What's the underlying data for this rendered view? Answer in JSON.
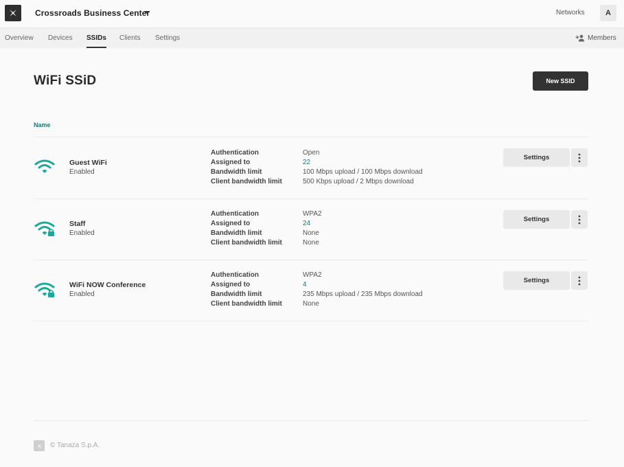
{
  "header": {
    "org_name": "Crossroads Business Center",
    "networks_label": "Networks",
    "avatar_initial": "A",
    "logo_icon": "tanaza-logo-icon"
  },
  "tabs": [
    {
      "label": "Overview",
      "active": false
    },
    {
      "label": "Devices",
      "active": false
    },
    {
      "label": "SSIDs",
      "active": true
    },
    {
      "label": "Clients",
      "active": false
    },
    {
      "label": "Settings",
      "active": false
    }
  ],
  "members_label": "Members",
  "page": {
    "title": "WiFi SSiD",
    "new_button": "New SSID",
    "column_name": "Name"
  },
  "labels": {
    "authentication": "Authentication",
    "assigned_to": "Assigned to",
    "bandwidth_limit": "Bandwidth limit",
    "client_bandwidth_limit": "Client bandwidth limit",
    "settings_button": "Settings"
  },
  "ssids": [
    {
      "name": "Guest WiFi",
      "status": "Enabled",
      "icon": "wifi-icon",
      "authentication": "Open",
      "assigned_to": "22",
      "bandwidth_limit": "100 Mbps upload / 100 Mbps download",
      "client_bandwidth_limit": "500 Kbps upload / 2 Mbps download"
    },
    {
      "name": "Staff",
      "status": "Enabled",
      "icon": "wifi-lock-icon",
      "authentication": "WPA2",
      "assigned_to": "24",
      "bandwidth_limit": "None",
      "client_bandwidth_limit": "None"
    },
    {
      "name": "WiFi NOW Conference",
      "status": "Enabled",
      "icon": "wifi-lock-icon",
      "authentication": "WPA2",
      "assigned_to": "4",
      "bandwidth_limit": "235 Mbps upload / 235 Mbps download",
      "client_bandwidth_limit": "None"
    }
  ],
  "footer": {
    "copyright": "© Tanaza S.p.A."
  },
  "colors": {
    "accent": "#1d7575",
    "wifi_icon": "#1aa89a",
    "primary_button": "#333333"
  }
}
